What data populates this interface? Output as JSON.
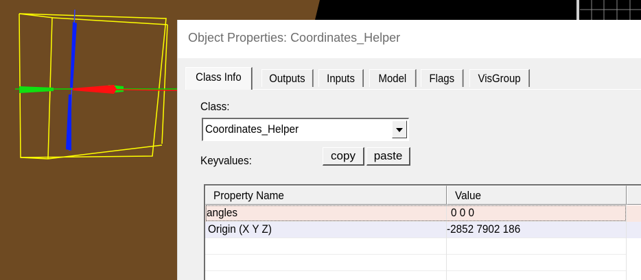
{
  "window": {
    "title": "Object Properties: Coordinates_Helper"
  },
  "tabs": [
    {
      "label": "Class Info",
      "active": true
    },
    {
      "label": "Outputs",
      "active": false
    },
    {
      "label": "Inputs",
      "active": false
    },
    {
      "label": "Model",
      "active": false
    },
    {
      "label": "Flags",
      "active": false
    },
    {
      "label": "VisGroup",
      "active": false
    }
  ],
  "class_section": {
    "label": "Class:",
    "selected": "Coordinates_Helper"
  },
  "keyvalues": {
    "label": "Keyvalues:",
    "copy_label": "copy",
    "paste_label": "paste"
  },
  "grid": {
    "columns": [
      "Property Name",
      "Value"
    ],
    "rows": [
      {
        "name": "angles",
        "value": "0 0 0",
        "selected": true
      },
      {
        "name": "Origin (X Y Z)",
        "value": "-2852 7902 186",
        "selected": false
      }
    ]
  },
  "colors": {
    "viewport_background": "#6e4a22",
    "bounding_box": "#ffff00",
    "axis_x": "#ff0000",
    "axis_y": "#00cc00",
    "axis_z": "#0000ff"
  }
}
